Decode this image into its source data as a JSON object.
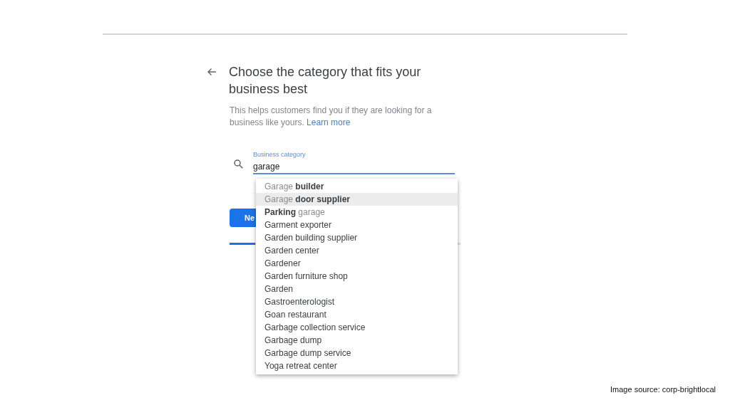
{
  "title": "Choose the category that fits your business best",
  "description": "This helps customers find you if they are looking for a business like yours.",
  "learn_more": "Learn more",
  "field": {
    "label": "Business category",
    "value": "garage"
  },
  "suggestions": [
    {
      "selected": false,
      "parts": [
        {
          "text": "Garage",
          "matched": true
        },
        {
          "text": " builder",
          "matched": false
        }
      ]
    },
    {
      "selected": true,
      "parts": [
        {
          "text": "Garage",
          "matched": true
        },
        {
          "text": " door supplier",
          "matched": false
        }
      ]
    },
    {
      "selected": false,
      "parts": [
        {
          "text": "Parking ",
          "matched": false
        },
        {
          "text": "garage",
          "matched": true
        }
      ]
    },
    {
      "selected": false,
      "parts": [
        {
          "text": "Garment exporter",
          "matched": false
        }
      ]
    },
    {
      "selected": false,
      "parts": [
        {
          "text": "Garden building supplier",
          "matched": false
        }
      ]
    },
    {
      "selected": false,
      "parts": [
        {
          "text": "Garden center",
          "matched": false
        }
      ]
    },
    {
      "selected": false,
      "parts": [
        {
          "text": "Gardener",
          "matched": false
        }
      ]
    },
    {
      "selected": false,
      "parts": [
        {
          "text": "Garden furniture shop",
          "matched": false
        }
      ]
    },
    {
      "selected": false,
      "parts": [
        {
          "text": "Garden",
          "matched": false
        }
      ]
    },
    {
      "selected": false,
      "parts": [
        {
          "text": "Gastroenterologist",
          "matched": false
        }
      ]
    },
    {
      "selected": false,
      "parts": [
        {
          "text": "Goan restaurant",
          "matched": false
        }
      ]
    },
    {
      "selected": false,
      "parts": [
        {
          "text": "Garbage collection service",
          "matched": false
        }
      ]
    },
    {
      "selected": false,
      "parts": [
        {
          "text": "Garbage dump",
          "matched": false
        }
      ]
    },
    {
      "selected": false,
      "parts": [
        {
          "text": "Garbage dump service",
          "matched": false
        }
      ]
    },
    {
      "selected": false,
      "parts": [
        {
          "text": "Yoga retreat center",
          "matched": false
        }
      ]
    }
  ],
  "next_button": "Ne",
  "progress": {
    "level": 0.11
  },
  "caption": "Image source: corp-brightlocal"
}
